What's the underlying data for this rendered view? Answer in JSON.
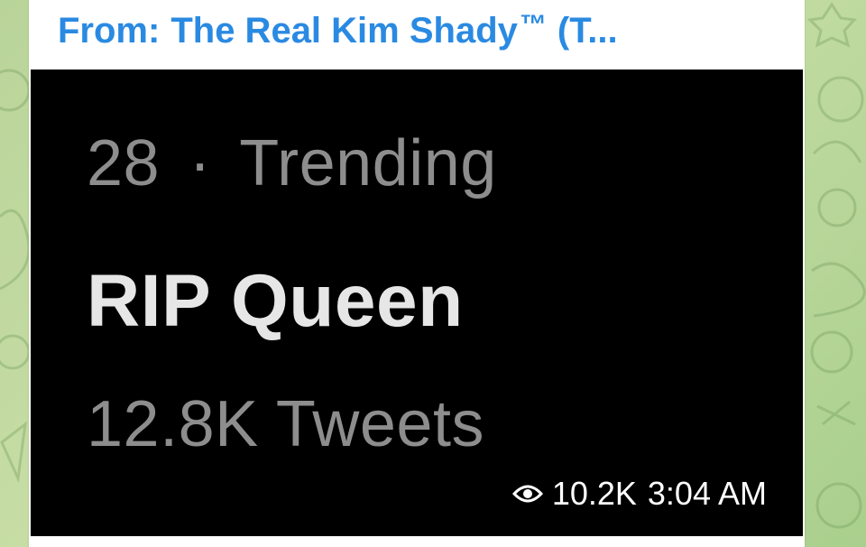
{
  "message": {
    "forwarded_from": {
      "prefix": "From:",
      "name": "The Real Kim Shady",
      "trademark": "™",
      "suffix": "(T..."
    },
    "image": {
      "trend_line": {
        "rank": "28",
        "separator": "·",
        "category": "Trending"
      },
      "topic": "RIP Queen",
      "tweet_count": "12.8K Tweets"
    },
    "views": "10.2K",
    "time": "3:04 AM",
    "icons": {
      "views": "eye-icon"
    }
  },
  "colors": {
    "sender_name": "#2a8ae2",
    "bubble": "#ffffff",
    "media_background": "#000000",
    "wallpaper": "#b9d49a"
  }
}
